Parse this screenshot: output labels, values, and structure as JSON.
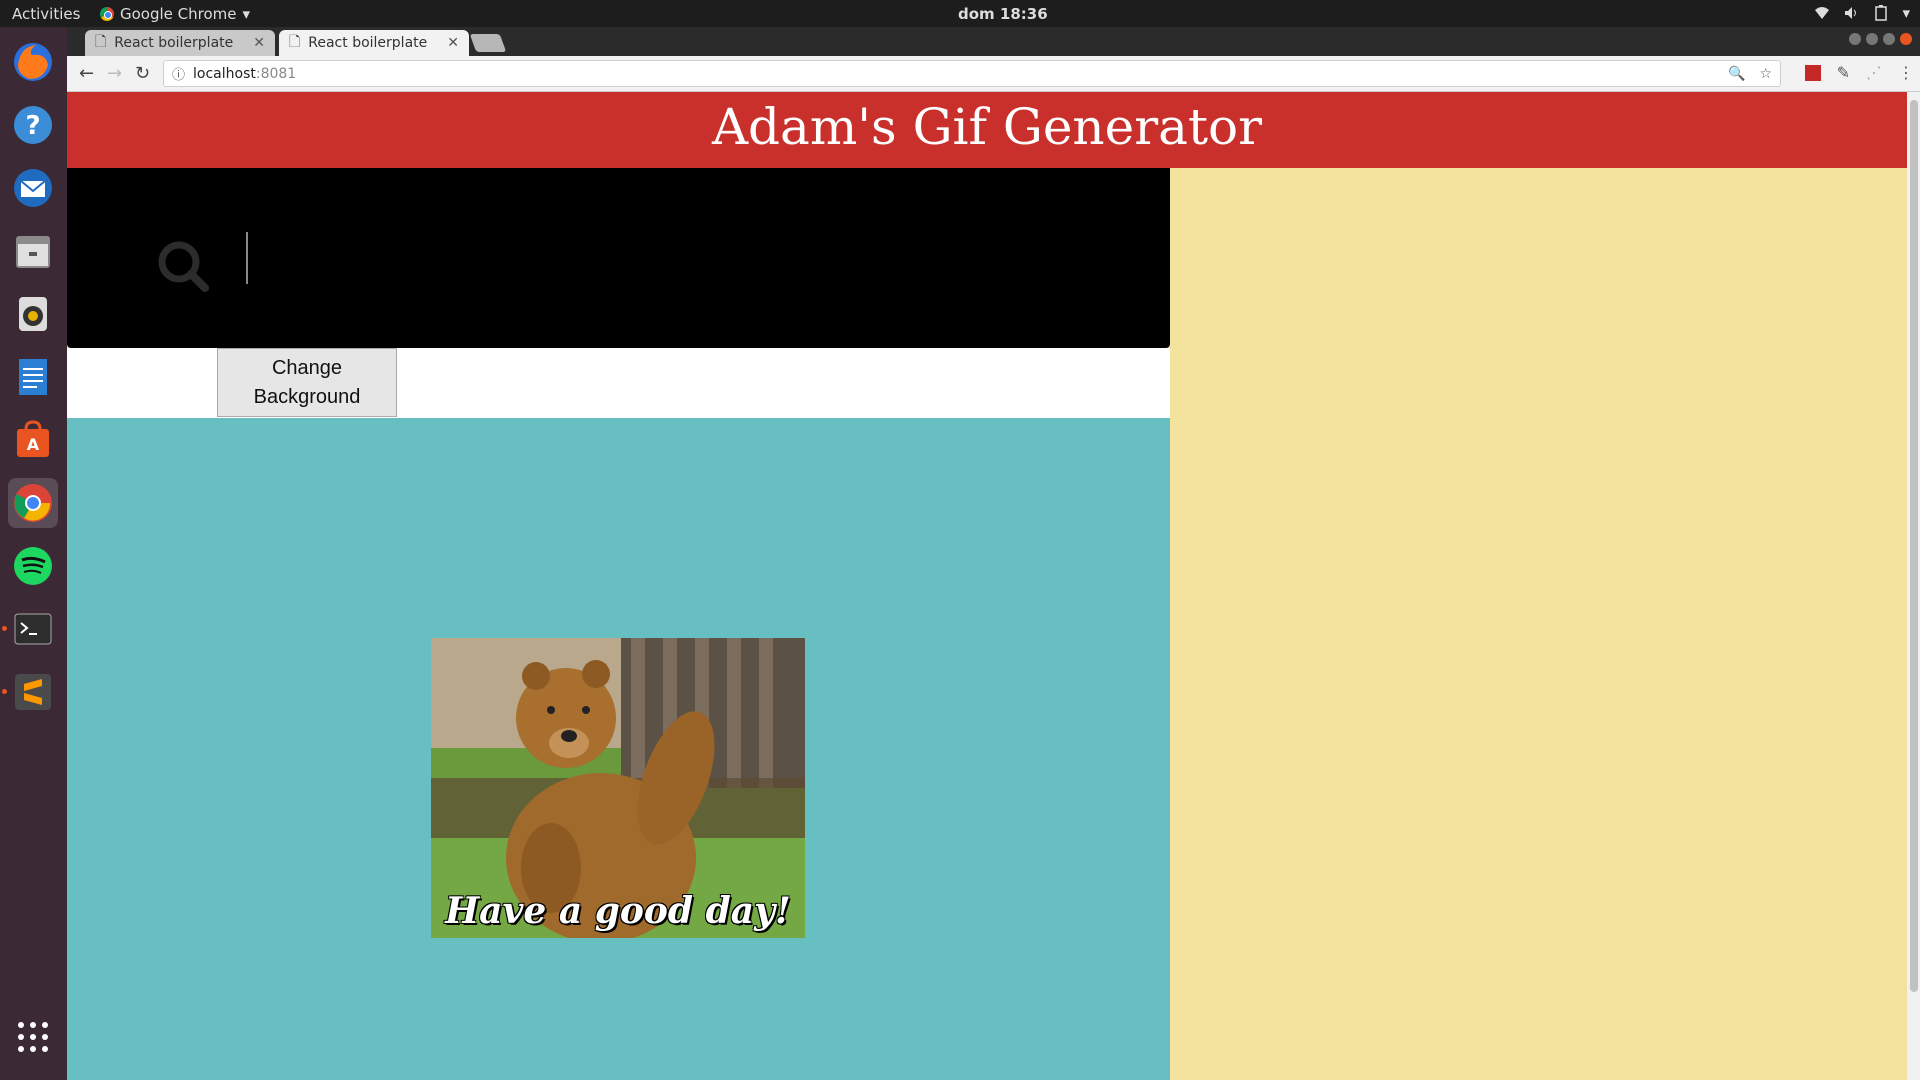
{
  "topbar": {
    "activities": "Activities",
    "app_name": "Google Chrome",
    "clock": "dom 18:36"
  },
  "dock": {
    "items": [
      "firefox-icon",
      "help-icon",
      "thunderbird-icon",
      "files-icon",
      "rhythmbox-icon",
      "writer-icon",
      "software-center-icon",
      "chrome-icon",
      "spotify-icon",
      "terminal-icon",
      "sublime-text-icon",
      "app-grid-icon"
    ]
  },
  "browser": {
    "tabs": [
      {
        "label": "React boilerplate",
        "active": false
      },
      {
        "label": "React boilerplate",
        "active": true
      }
    ],
    "url_host": "localhost",
    "url_port": ":8081"
  },
  "page": {
    "title": "Adam's Gif Generator",
    "search": {
      "value": "",
      "placeholder": ""
    },
    "change_background_button": "Change Background",
    "gif_caption": "Have a good day!",
    "colors": {
      "header": "#c9302c",
      "search_bg": "#000000",
      "gif_area_bg": "#67bfc2",
      "side_bg": "#f3e39f"
    }
  }
}
